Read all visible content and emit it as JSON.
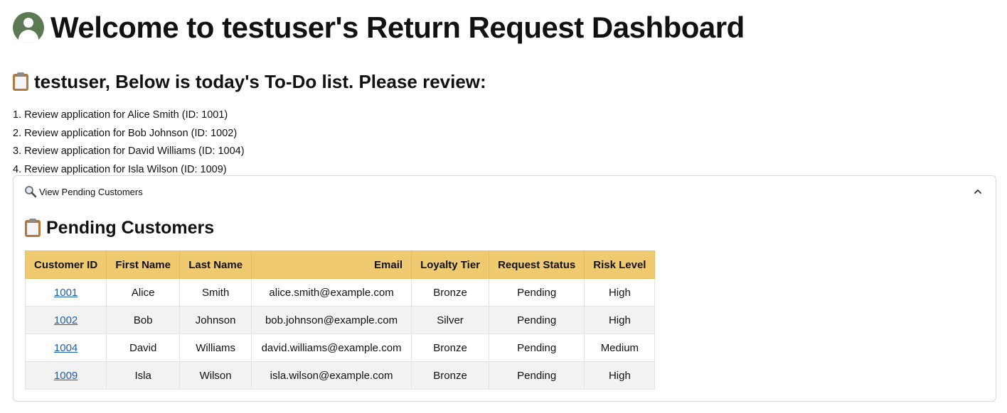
{
  "header": {
    "title": "Welcome to testuser's Return Request Dashboard"
  },
  "todo": {
    "heading": "testuser, Below is today's To-Do list. Please review:",
    "items": [
      "1. Review application for Alice Smith (ID: 1001)",
      "2. Review application for Bob Johnson (ID: 1002)",
      "3. Review application for David Williams (ID: 1004)",
      "4. Review application for Isla Wilson (ID: 1009)"
    ]
  },
  "expander": {
    "label": "View Pending Customers",
    "icon": "magnifier-icon",
    "expanded": true
  },
  "pending": {
    "title": "Pending Customers",
    "columns": [
      "Customer ID",
      "First Name",
      "Last Name",
      "Email",
      "Loyalty Tier",
      "Request Status",
      "Risk Level"
    ],
    "rows": [
      [
        "1001",
        "Alice",
        "Smith",
        "alice.smith@example.com",
        "Bronze",
        "Pending",
        "High"
      ],
      [
        "1002",
        "Bob",
        "Johnson",
        "bob.johnson@example.com",
        "Silver",
        "Pending",
        "High"
      ],
      [
        "1004",
        "David",
        "Williams",
        "david.williams@example.com",
        "Bronze",
        "Pending",
        "Medium"
      ],
      [
        "1009",
        "Isla",
        "Wilson",
        "isla.wilson@example.com",
        "Bronze",
        "Pending",
        "High"
      ]
    ]
  },
  "colors": {
    "header_bg": "#f0ca71",
    "avatar": "#5c7a52",
    "link": "#1a5fb4",
    "alt_row": "#f2f2f2"
  }
}
